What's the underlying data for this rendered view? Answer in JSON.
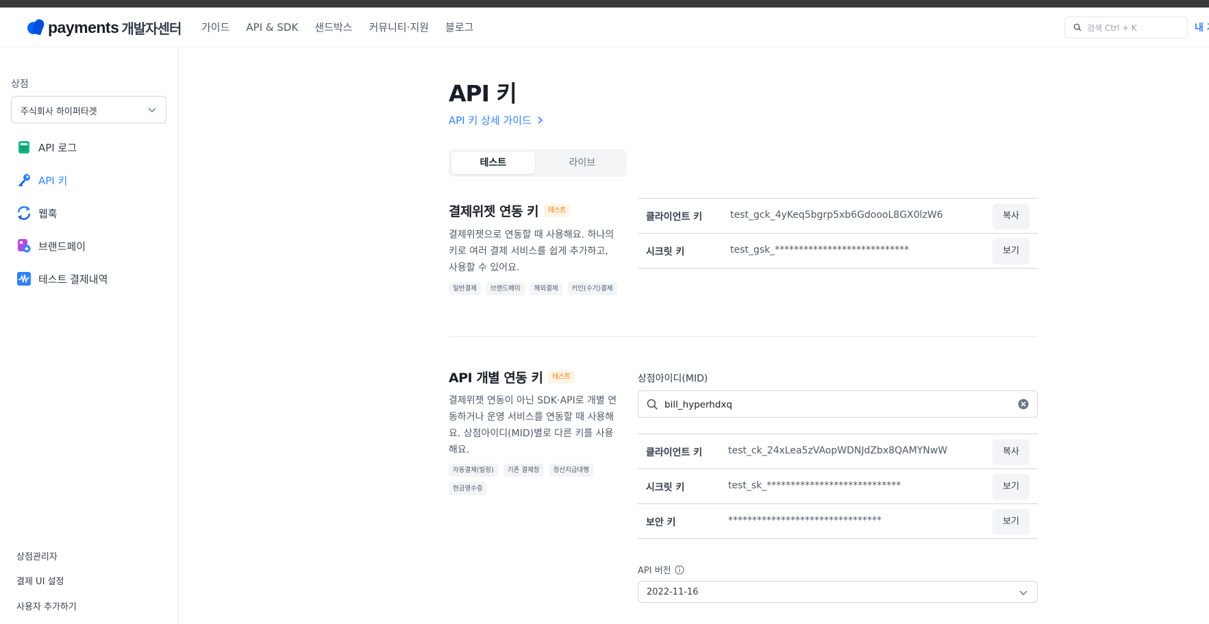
{
  "header": {
    "logo_word": "payments",
    "logo_sub": "개발자센터",
    "nav": [
      "가이드",
      "API & SDK",
      "샌드박스",
      "커뮤니티·지원",
      "블로그"
    ],
    "search_placeholder": "검색 Ctrl + K",
    "my_link": "내 개"
  },
  "sidebar": {
    "shop_label": "상점",
    "shop_selected": "주식회사 하이퍼타겟",
    "items": [
      {
        "label": "API 로그",
        "icon": "log-icon"
      },
      {
        "label": "API 키",
        "icon": "key-icon"
      },
      {
        "label": "웹훅",
        "icon": "webhook-icon"
      },
      {
        "label": "브랜드페이",
        "icon": "brandpay-icon"
      },
      {
        "label": "테스트 결제내역",
        "icon": "test-history-icon"
      }
    ],
    "footer": [
      "상점관리자",
      "결제 UI 설정",
      "사용자 추가하기"
    ]
  },
  "main": {
    "title": "API 키",
    "guide_link": "API 키 상세 가이드",
    "tabs": [
      "테스트",
      "라이브"
    ],
    "widget": {
      "title": "결제위젯 연동 키",
      "badge": "테스트",
      "desc": "결제위젯으로 연동할 때 사용해요. 하나의 키로 여러 결제 서비스를 쉽게 추가하고, 사용할 수 있어요.",
      "tags": [
        "일반결제",
        "브랜드페이",
        "해외결제",
        "키인(수기)결제"
      ],
      "keys": [
        {
          "label": "클라이언트 키",
          "value": "test_gck_4yKeq5bgrp5xb6GdoooL8GX0lzW6",
          "action": "복사"
        },
        {
          "label": "시크릿 키",
          "value": "test_gsk_****************************",
          "action": "보기"
        }
      ]
    },
    "api": {
      "title": "API 개별 연동 키",
      "badge": "테스트",
      "desc": "결제위젯 연동이 아닌 SDK·API로 개별 연동하거나 운영 서비스를 연동할 때 사용해요. 상점아이디(MID)별로 다른 키를 사용해요.",
      "tags": [
        "자동결제(빌링)",
        "기존 결제창",
        "정산지급대행",
        "현금영수증"
      ],
      "mid_label": "상점아이디(MID)",
      "mid_value": "bill_hyperhdxq",
      "keys": [
        {
          "label": "클라이언트 키",
          "value": "test_ck_24xLea5zVAopWDNJdZbx8QAMYNwW",
          "action": "복사"
        },
        {
          "label": "시크릿 키",
          "value": "test_sk_****************************",
          "action": "보기"
        },
        {
          "label": "보안 키",
          "value": "********************************",
          "action": "보기"
        }
      ],
      "version_label": "API 버전",
      "version_value": "2022-11-16"
    }
  },
  "colors": {
    "accent": "#3182f6",
    "badge_bg": "#fff4e5",
    "badge_text": "#e87a00"
  }
}
